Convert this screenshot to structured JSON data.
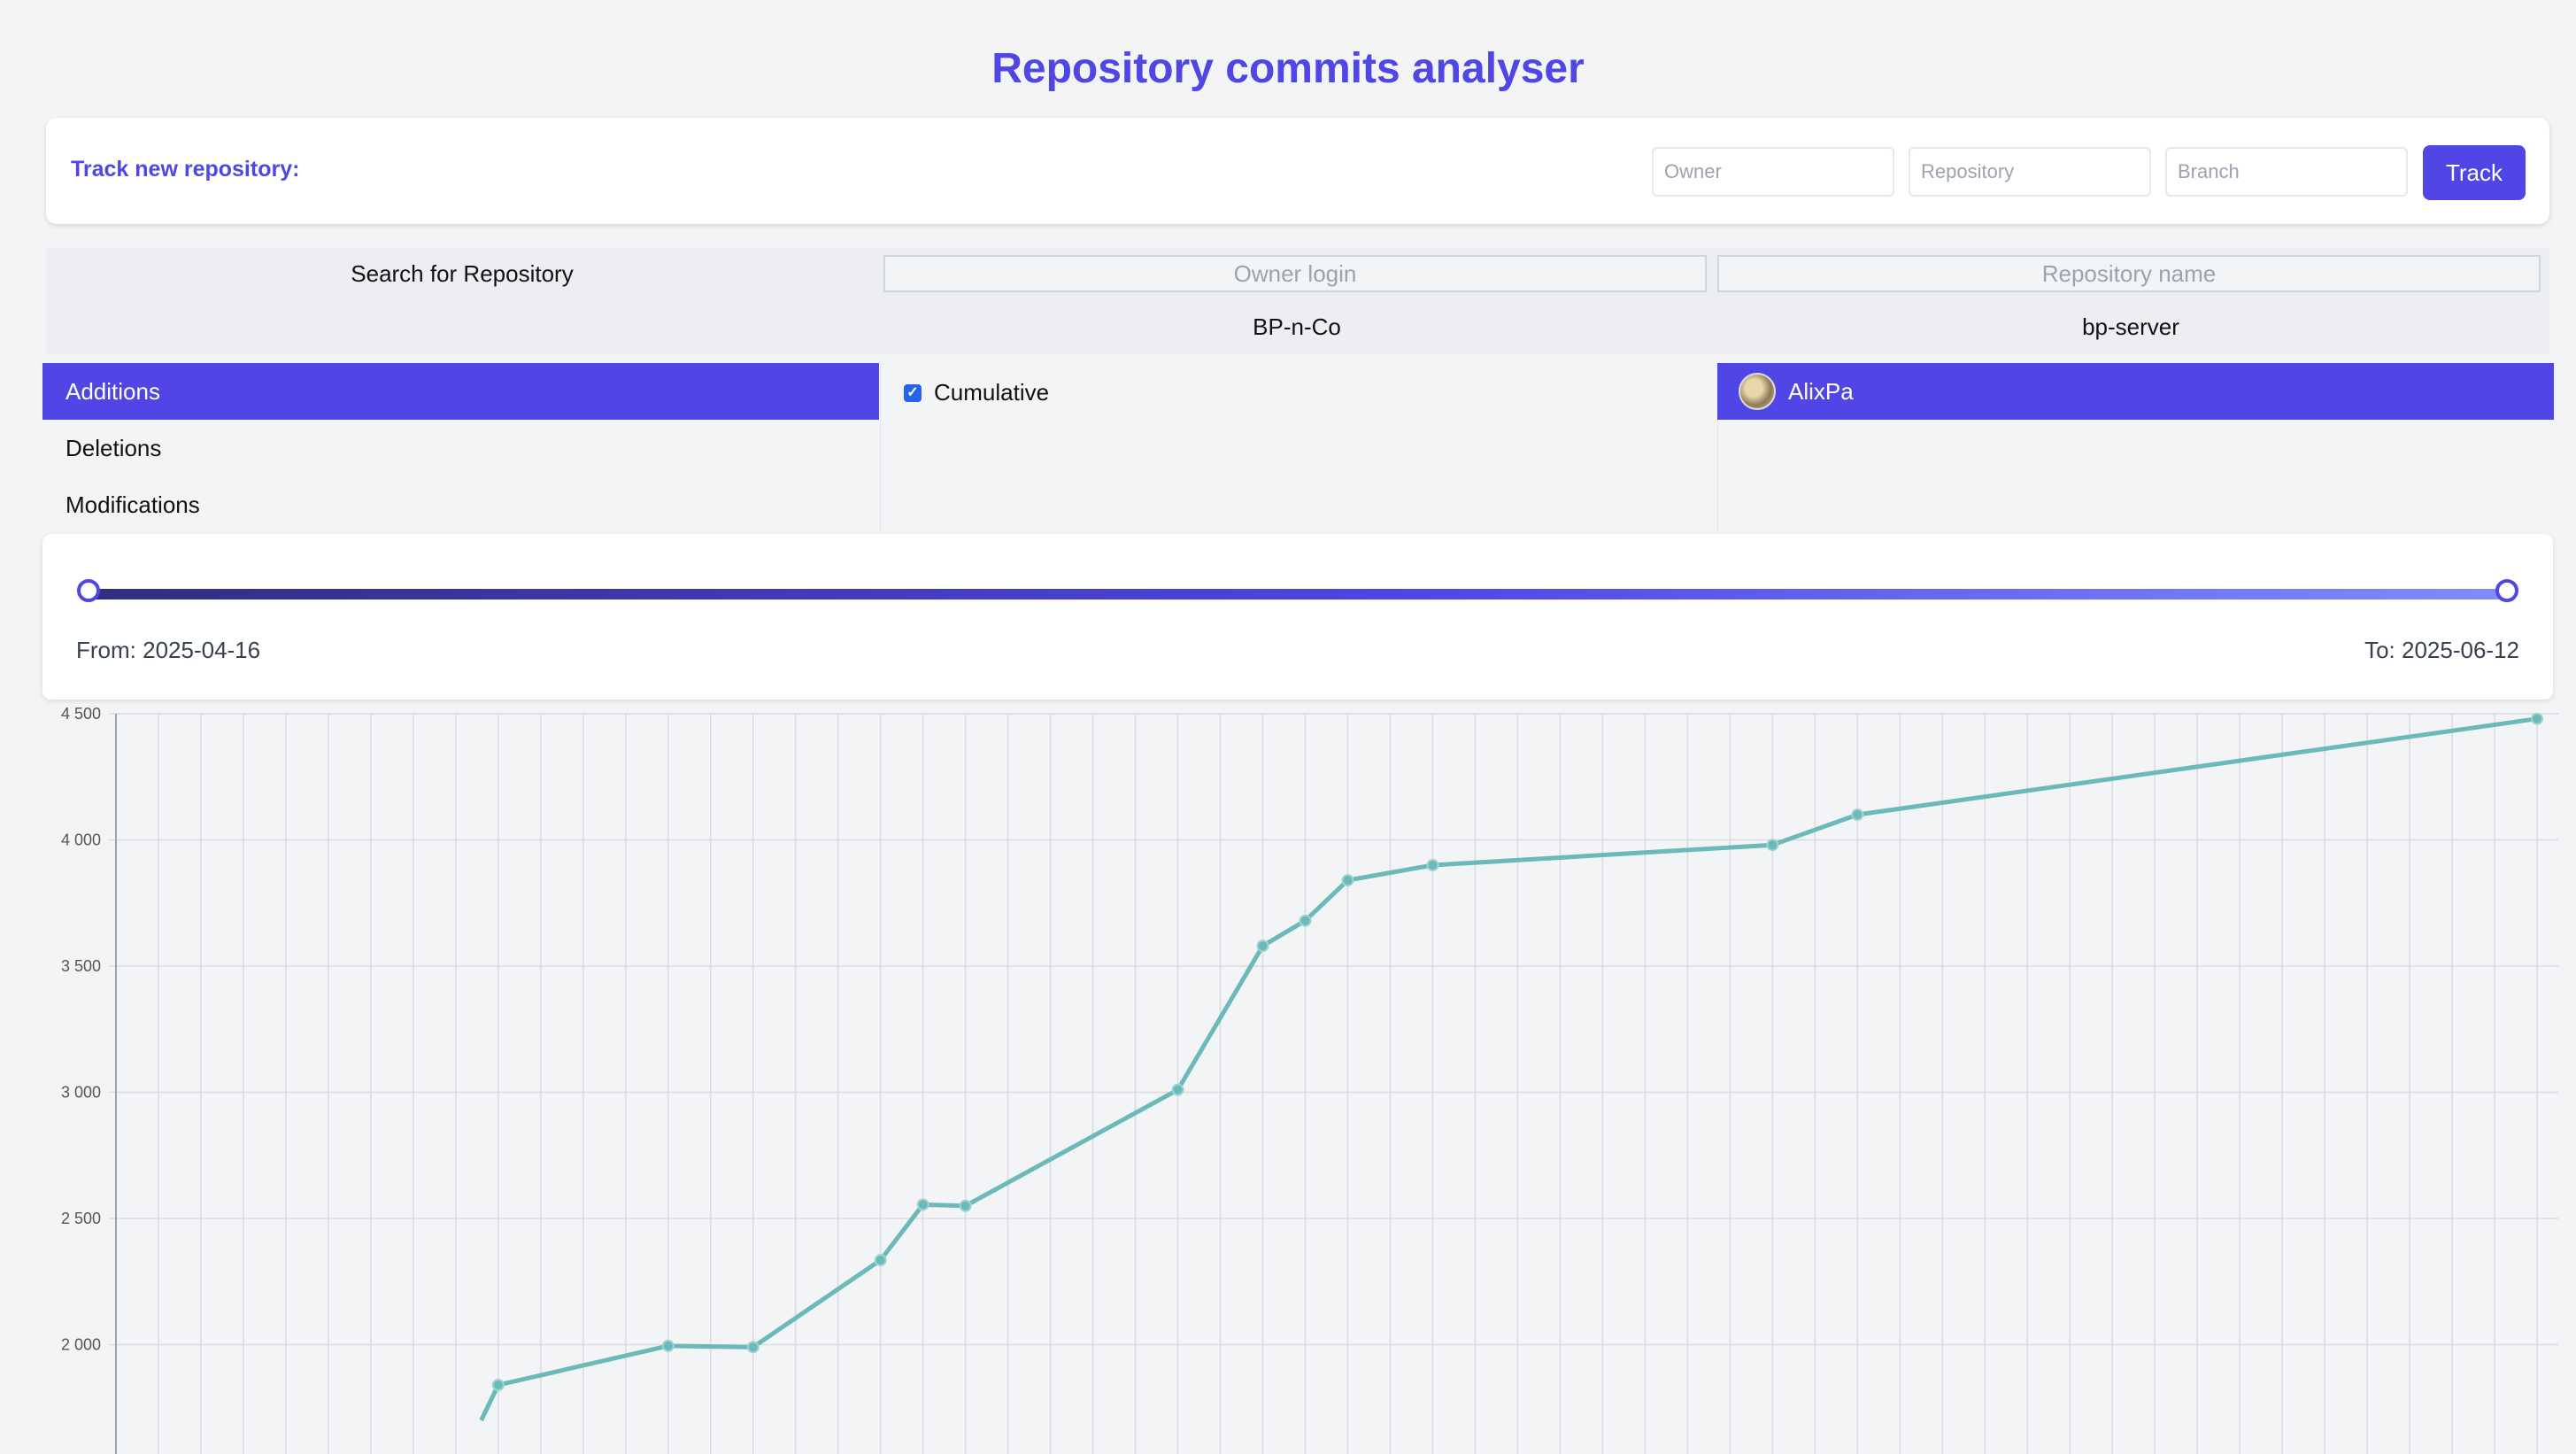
{
  "title": "Repository commits analyser",
  "track": {
    "label": "Track new repository:",
    "owner_placeholder": "Owner",
    "repository_placeholder": "Repository",
    "branch_placeholder": "Branch",
    "button_label": "Track"
  },
  "search": {
    "label": "Search for Repository",
    "owner_placeholder": "Owner login",
    "repo_placeholder": "Repository name",
    "owner_result": "BP-n-Co",
    "repo_result": "bp-server"
  },
  "metrics": [
    {
      "label": "Additions",
      "selected": true
    },
    {
      "label": "Deletions",
      "selected": false
    },
    {
      "label": "Modifications",
      "selected": false
    }
  ],
  "options": {
    "cumulative_label": "Cumulative",
    "cumulative_checked": true
  },
  "users": [
    {
      "name": "AlixPa",
      "selected": true
    }
  ],
  "date_range": {
    "from": "From: 2025-04-16",
    "to": "To: 2025-06-12",
    "selection_start": 0,
    "selection_end": 1
  },
  "colors": {
    "accent": "#4f46e5",
    "line": "#6bbab9"
  },
  "chart_data": {
    "type": "line",
    "ylim": [
      1700,
      4500
    ],
    "y_ticks": [
      "4 500",
      "4 000",
      "3 500",
      "3 000",
      "2 500",
      "2 000"
    ],
    "y_tick_values": [
      4500,
      4000,
      3500,
      3000,
      2500,
      2000
    ],
    "x_range": [
      0,
      57
    ],
    "grid": true,
    "series": [
      {
        "x": [
          9,
          13,
          15,
          18,
          19,
          20,
          25,
          27,
          28,
          29,
          31,
          39,
          41,
          57
        ],
        "values": [
          1840,
          1995,
          1990,
          2335,
          2555,
          2550,
          3010,
          3580,
          3680,
          3840,
          3900,
          3980,
          4100,
          4480
        ]
      }
    ]
  }
}
